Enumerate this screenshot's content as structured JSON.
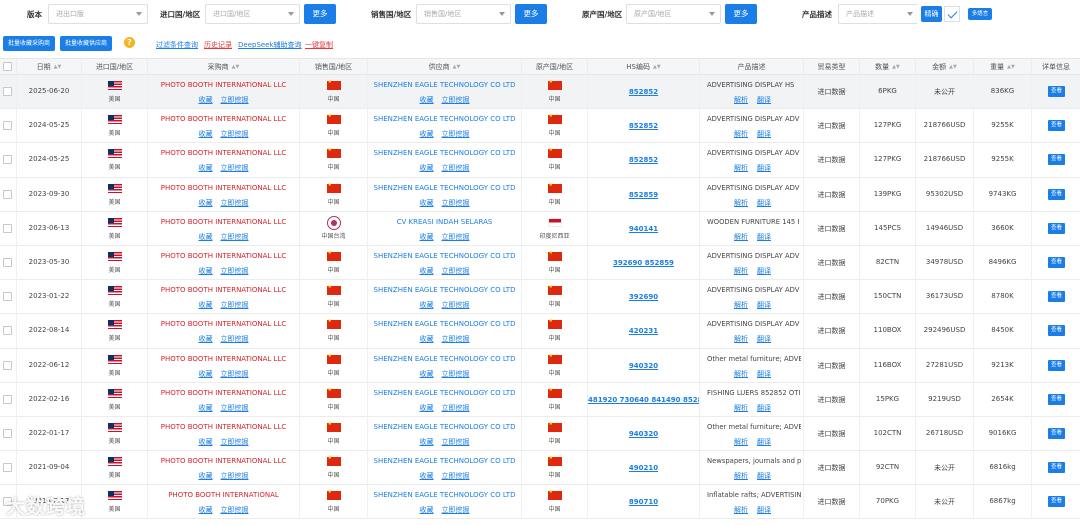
{
  "filters": {
    "edition_label": "版本",
    "edition_placeholder": "进出口版",
    "import_country_label": "进口国/地区",
    "import_country_placeholder": "进口国/地区",
    "sales_country_label": "销售国/地区",
    "sales_country_placeholder": "销售国/地区",
    "origin_country_label": "原产国/地区",
    "origin_country_placeholder": "原产国/地区",
    "more_label": "更多",
    "product_desc_label": "产品描述",
    "product_desc_placeholder": "产品描述",
    "exact_label": "精确",
    "multi_select_label": "多語言"
  },
  "actions": {
    "batch_buyer": "批量收藏采购商",
    "batch_supplier": "批量收藏供应商",
    "filter_query": "过滤条件查询",
    "history": "历史记录",
    "deepseek": "DeepSeek辅助查询",
    "copy_all": "一键复制"
  },
  "headers": {
    "date": "日期",
    "import_country": "进口国/地区",
    "buyer": "采购商",
    "sales_country": "销售国/地区",
    "supplier": "供应商",
    "origin_country": "原产国/地区",
    "hs_code": "HS编码",
    "product_desc": "产品描述",
    "trade_type": "贸易类型",
    "quantity": "数量",
    "amount": "金额",
    "weight": "重量",
    "detail": "详单信息"
  },
  "labels": {
    "collect": "收藏",
    "dig": "立即挖掘",
    "analyze": "解析",
    "translate": "翻译",
    "view": "查看"
  },
  "rows": [
    {
      "date": "2025-06-20",
      "import_country": "美国",
      "buyer": "PHOTO BOOTH INTERNATIONAL LLC",
      "sales_country": "中国",
      "supplier": "SHENZHEN EAGLE TECHNOLOGY CO LTD",
      "origin_country": "中国",
      "hs_code": "852852",
      "desc": "ADVERTISING DISPLAY HS",
      "trade_type": "进口数据",
      "quantity": "6PKG",
      "amount": "未公开",
      "weight": "836KG"
    },
    {
      "date": "2024-05-25",
      "import_country": "美国",
      "buyer": "PHOTO BOOTH INTERNATIONAL LLC",
      "sales_country": "中国",
      "supplier": "SHENZHEN EAGLE TECHNOLOGY CO LTD",
      "origin_country": "中国",
      "hs_code": "852852",
      "desc": "ADVERTISING DISPLAY ADV",
      "trade_type": "进口数据",
      "quantity": "127PKG",
      "amount": "218766USD",
      "weight": "9255K"
    },
    {
      "date": "2024-05-25",
      "import_country": "美国",
      "buyer": "PHOTO BOOTH INTERNATIONAL LLC",
      "sales_country": "中国",
      "supplier": "SHENZHEN EAGLE TECHNOLOGY CO LTD",
      "origin_country": "中国",
      "hs_code": "852852",
      "desc": "ADVERTISING DISPLAY ADV",
      "trade_type": "进口数据",
      "quantity": "127PKG",
      "amount": "218766USD",
      "weight": "9255K"
    },
    {
      "date": "2023-09-30",
      "import_country": "美国",
      "buyer": "PHOTO BOOTH INTERNATIONAL LLC",
      "sales_country": "中国",
      "supplier": "SHENZHEN EAGLE TECHNOLOGY CO LTD",
      "origin_country": "中国",
      "hs_code": "852859",
      "desc": "ADVERTISING DISPLAY ADV",
      "trade_type": "进口数据",
      "quantity": "139PKG",
      "amount": "95302USD",
      "weight": "9743KG"
    },
    {
      "date": "2023-06-13",
      "import_country": "美国",
      "buyer": "PHOTO BOOTH INTERNATIONAL LLC",
      "sales_country": "中国台湾",
      "supplier": "CV KREASI INDAH SELARAS",
      "origin_country": "印度尼西亚",
      "hs_code": "940141",
      "desc": "WOODEN FURNITURE 145 I",
      "trade_type": "进口数据",
      "quantity": "145PCS",
      "amount": "14946USD",
      "weight": "3660K"
    },
    {
      "date": "2023-05-30",
      "import_country": "美国",
      "buyer": "PHOTO BOOTH INTERNATIONAL LLC",
      "sales_country": "中国",
      "supplier": "SHENZHEN EAGLE TECHNOLOGY CO LTD",
      "origin_country": "中国",
      "hs_code": "392690 852859",
      "desc": "ADVERTISING DISPLAY ADV",
      "trade_type": "进口数据",
      "quantity": "82CTN",
      "amount": "34978USD",
      "weight": "8496KG"
    },
    {
      "date": "2023-01-22",
      "import_country": "美国",
      "buyer": "PHOTO BOOTH INTERNATIONAL LLC",
      "sales_country": "中国",
      "supplier": "SHENZHEN EAGLE TECHNOLOGY CO LTD",
      "origin_country": "中国",
      "hs_code": "392690",
      "desc": "ADVERTISING DISPLAY ADV",
      "trade_type": "进口数据",
      "quantity": "150CTN",
      "amount": "36173USD",
      "weight": "8780K"
    },
    {
      "date": "2022-08-14",
      "import_country": "美国",
      "buyer": "PHOTO BOOTH INTERNATIONAL LLC",
      "sales_country": "中国",
      "supplier": "SHENZHEN EAGLE TECHNOLOGY CO LTD",
      "origin_country": "中国",
      "hs_code": "420231",
      "desc": "ADVERTISING DISPLAY ADV",
      "trade_type": "进口数据",
      "quantity": "110BOX",
      "amount": "292496USD",
      "weight": "8450K"
    },
    {
      "date": "2022-06-12",
      "import_country": "美国",
      "buyer": "PHOTO BOOTH INTERNATIONAL LLC",
      "sales_country": "中国",
      "supplier": "SHENZHEN EAGLE TECHNOLOGY CO LTD",
      "origin_country": "中国",
      "hs_code": "940320",
      "desc": "Other metal furniture; ADVER",
      "trade_type": "进口数据",
      "quantity": "116BOX",
      "amount": "27281USD",
      "weight": "9213K"
    },
    {
      "date": "2022-02-16",
      "import_country": "美国",
      "buyer": "PHOTO BOOTH INTERNATIONAL LLC",
      "sales_country": "中国",
      "supplier": "SHENZHEN EAGLE TECHNOLOGY CO LTD",
      "origin_country": "中国",
      "hs_code": "481920 730640 841490 852852",
      "desc": "FISHING LUERS 852852 OTI",
      "trade_type": "进口数据",
      "quantity": "15PKG",
      "amount": "9219USD",
      "weight": "2654K"
    },
    {
      "date": "2022-01-17",
      "import_country": "美国",
      "buyer": "PHOTO BOOTH INTERNATIONAL LLC",
      "sales_country": "中国",
      "supplier": "SHENZHEN EAGLE TECHNOLOGY CO LTD",
      "origin_country": "中国",
      "hs_code": "940320",
      "desc": "Other metal furniture; ADVER",
      "trade_type": "进口数据",
      "quantity": "102CTN",
      "amount": "26718USD",
      "weight": "9016KG"
    },
    {
      "date": "2021-09-04",
      "import_country": "美国",
      "buyer": "PHOTO BOOTH INTERNATIONAL LLC",
      "sales_country": "中国",
      "supplier": "SHENZHEN EAGLE TECHNOLOGY CO LTD",
      "origin_country": "中国",
      "hs_code": "490210",
      "desc": "Newspapers, journals and per",
      "trade_type": "进口数据",
      "quantity": "92CTN",
      "amount": "未公开",
      "weight": "6816kg"
    },
    {
      "date": "2021-08-17",
      "import_country": "美国",
      "buyer": "PHOTO BOOTH INTERNATIONAL",
      "sales_country": "中国",
      "supplier": "SHENZHEN EAGLE TECHNOLOGY CO LTD",
      "origin_country": "中国",
      "hs_code": "890710",
      "desc": "Inflatable rafts; ADVERTISIN",
      "trade_type": "进口数据",
      "quantity": "70PKG",
      "amount": "未公开",
      "weight": "6867kg"
    }
  ],
  "watermark": "大数跨境"
}
